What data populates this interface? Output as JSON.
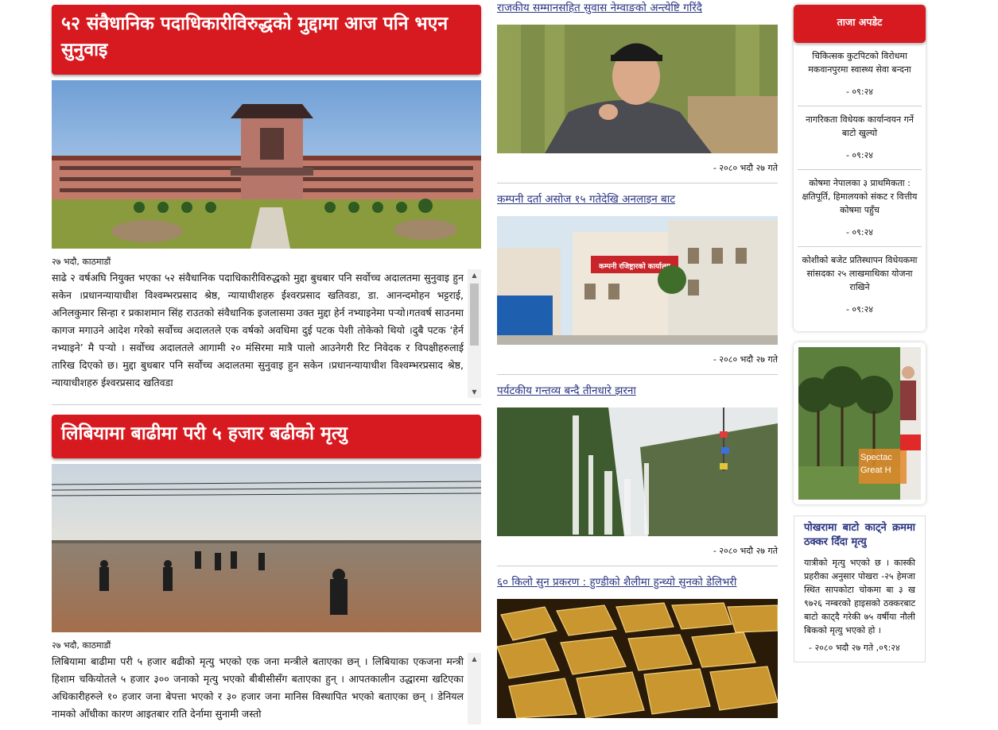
{
  "left": {
    "stories": [
      {
        "headline": "५२ संवैधानिक पदाधिकारीविरुद्धको मुद्दामा आज पनि भएन सुनुवाइ",
        "meta": "२७ भदौ, काठमाडौं",
        "body": "साढे २ वर्षअघि नियुक्त भएका ५२ संवैधानिक पदाधिकारीविरुद्धको मुद्दा बुधबार पनि सर्वोच्च अदालतमा सुनुवाइ हुन सकेन ।प्रधानन्यायाधीश विश्वम्भरप्रसाद श्रेष्ठ, न्यायाधीशहरु ईश्वरप्रसाद खतिवडा, डा. आनन्दमोहन भट्टराई, अनिलकुमार सिन्हा र प्रकाशमान सिंह राउतको संवैधानिक इजलासमा उक्त मुद्दा हेर्न नभ्याइनेमा पर्‍यो।गतवर्ष साउनमा कागज मगाउने आदेश गरेको सर्वोच्च अदालतले एक वर्षको अवधिमा दुई पटक पेशी तोकेको थियो ।दुबै पटक ‘हेर्न नभ्याइने’ मै पर्‍यो । सर्वोच्च अदालतले आगामी २० मंसिरमा मात्रै पालो आउनेगरी रिट निवेदक र विपक्षीहरुलाई तारिख दिएको छ। मुद्दा बुधबार पनि सर्वोच्च अदालतमा सुनुवाइ हुन सकेन ।प्रधानन्यायाधीश विश्वम्भरप्रसाद श्रेष्ठ, न्यायाधीशहरु ईश्वरप्रसाद खतिवडा"
      },
      {
        "headline": "लिबियामा बाढीमा परी ५ हजार बढीको मृत्यु",
        "meta": "२७ भदौ, काठमाडौं",
        "body": "लिबियामा बाढीमा परी ५ हजार बढीको मृत्यु भएको एक जना मन्त्रीले बताएका छन् । लिबियाका एकजना मन्त्री हिशाम चकियोतले ५ हजार ३०० जनाको मृत्यु भएको बीबीसीसँग बताएका हुन् । आपतकालीन उद्धारमा खटिएका अधिकारीहरुले १० हजार जना बेपत्ता भएको र ३० हजार जना मानिस विस्थापित भएको बताएका छन् । डेनियल नामको आँधीका कारण आइतबार राति देर्नामा सुनामी जस्तो"
      }
    ]
  },
  "middle": {
    "items": [
      {
        "title": "राजकीय सम्मानसहित सुवास नेम्वाङको अन्त्येष्टि गरिंदै",
        "date": "- २०८० भदौ २७ गते"
      },
      {
        "title": "कम्पनी दर्ता असोज १५ गतेदेखि अनलाइन बाट",
        "date": "- २०८० भदौ २७ गते",
        "sign_text": "कम्पनी रजिष्ट्रारको कार्यालय"
      },
      {
        "title": "पर्यटकीय गन्तव्य बन्दै तीनधारे झरना",
        "date": "- २०८० भदौ २७ गते"
      },
      {
        "title": "६० किलो सुन प्रकरण : हुण्डीको शैलीमा हुन्थ्यो सुनको डेलिभरी",
        "date": ""
      }
    ]
  },
  "right": {
    "updates_title": "ताजा अपडेट",
    "updates": [
      {
        "title": "चिकित्सक कुटपिटको विरोधमा मकवानपुरमा स्वास्थ्य सेवा बन्दना",
        "time": "- ०९:२४"
      },
      {
        "title": "नागरिकता विधेयक कार्यान्वयन गर्ने बाटो खुल्यो",
        "time": "- ०९:२४"
      },
      {
        "title": "कोषमा नेपालका ३ प्राथमिकता : क्षतिपूर्ति, हिमालयको संकट र वित्तीय कोषमा पहुँच",
        "time": "- ०९:२४"
      },
      {
        "title": "कोशीको बजेट प्रतिस्थापन विधेयकमा सांसदका २५ लाखमाथिका योजना राखिने",
        "time": "- ०९:२४"
      }
    ],
    "ad_text_1": "Spectac",
    "ad_text_2": "Great H",
    "story": {
      "title": "पोखरामा बाटो काट्ने क्रममा ठक्कर दिँदा मृत्यु",
      "body": "यात्रीको मृत्यु भएको छ । कास्की प्रहरीका अनुसार पोखरा -२५ हेमजा स्थित सापकोटा चोकमा बा ३ ख ९७२६ नम्बरको हाइसको ठक्करबाट बाटो काट्दै गरेकी ७५ वर्षीया नौली बिकको मृत्यु भएको हो ।",
      "date": "- २०८० भदौ २७ गते ,०९:२४"
    }
  },
  "colors": {
    "accent_red": "#d71920",
    "link_blue": "#2a3580"
  }
}
